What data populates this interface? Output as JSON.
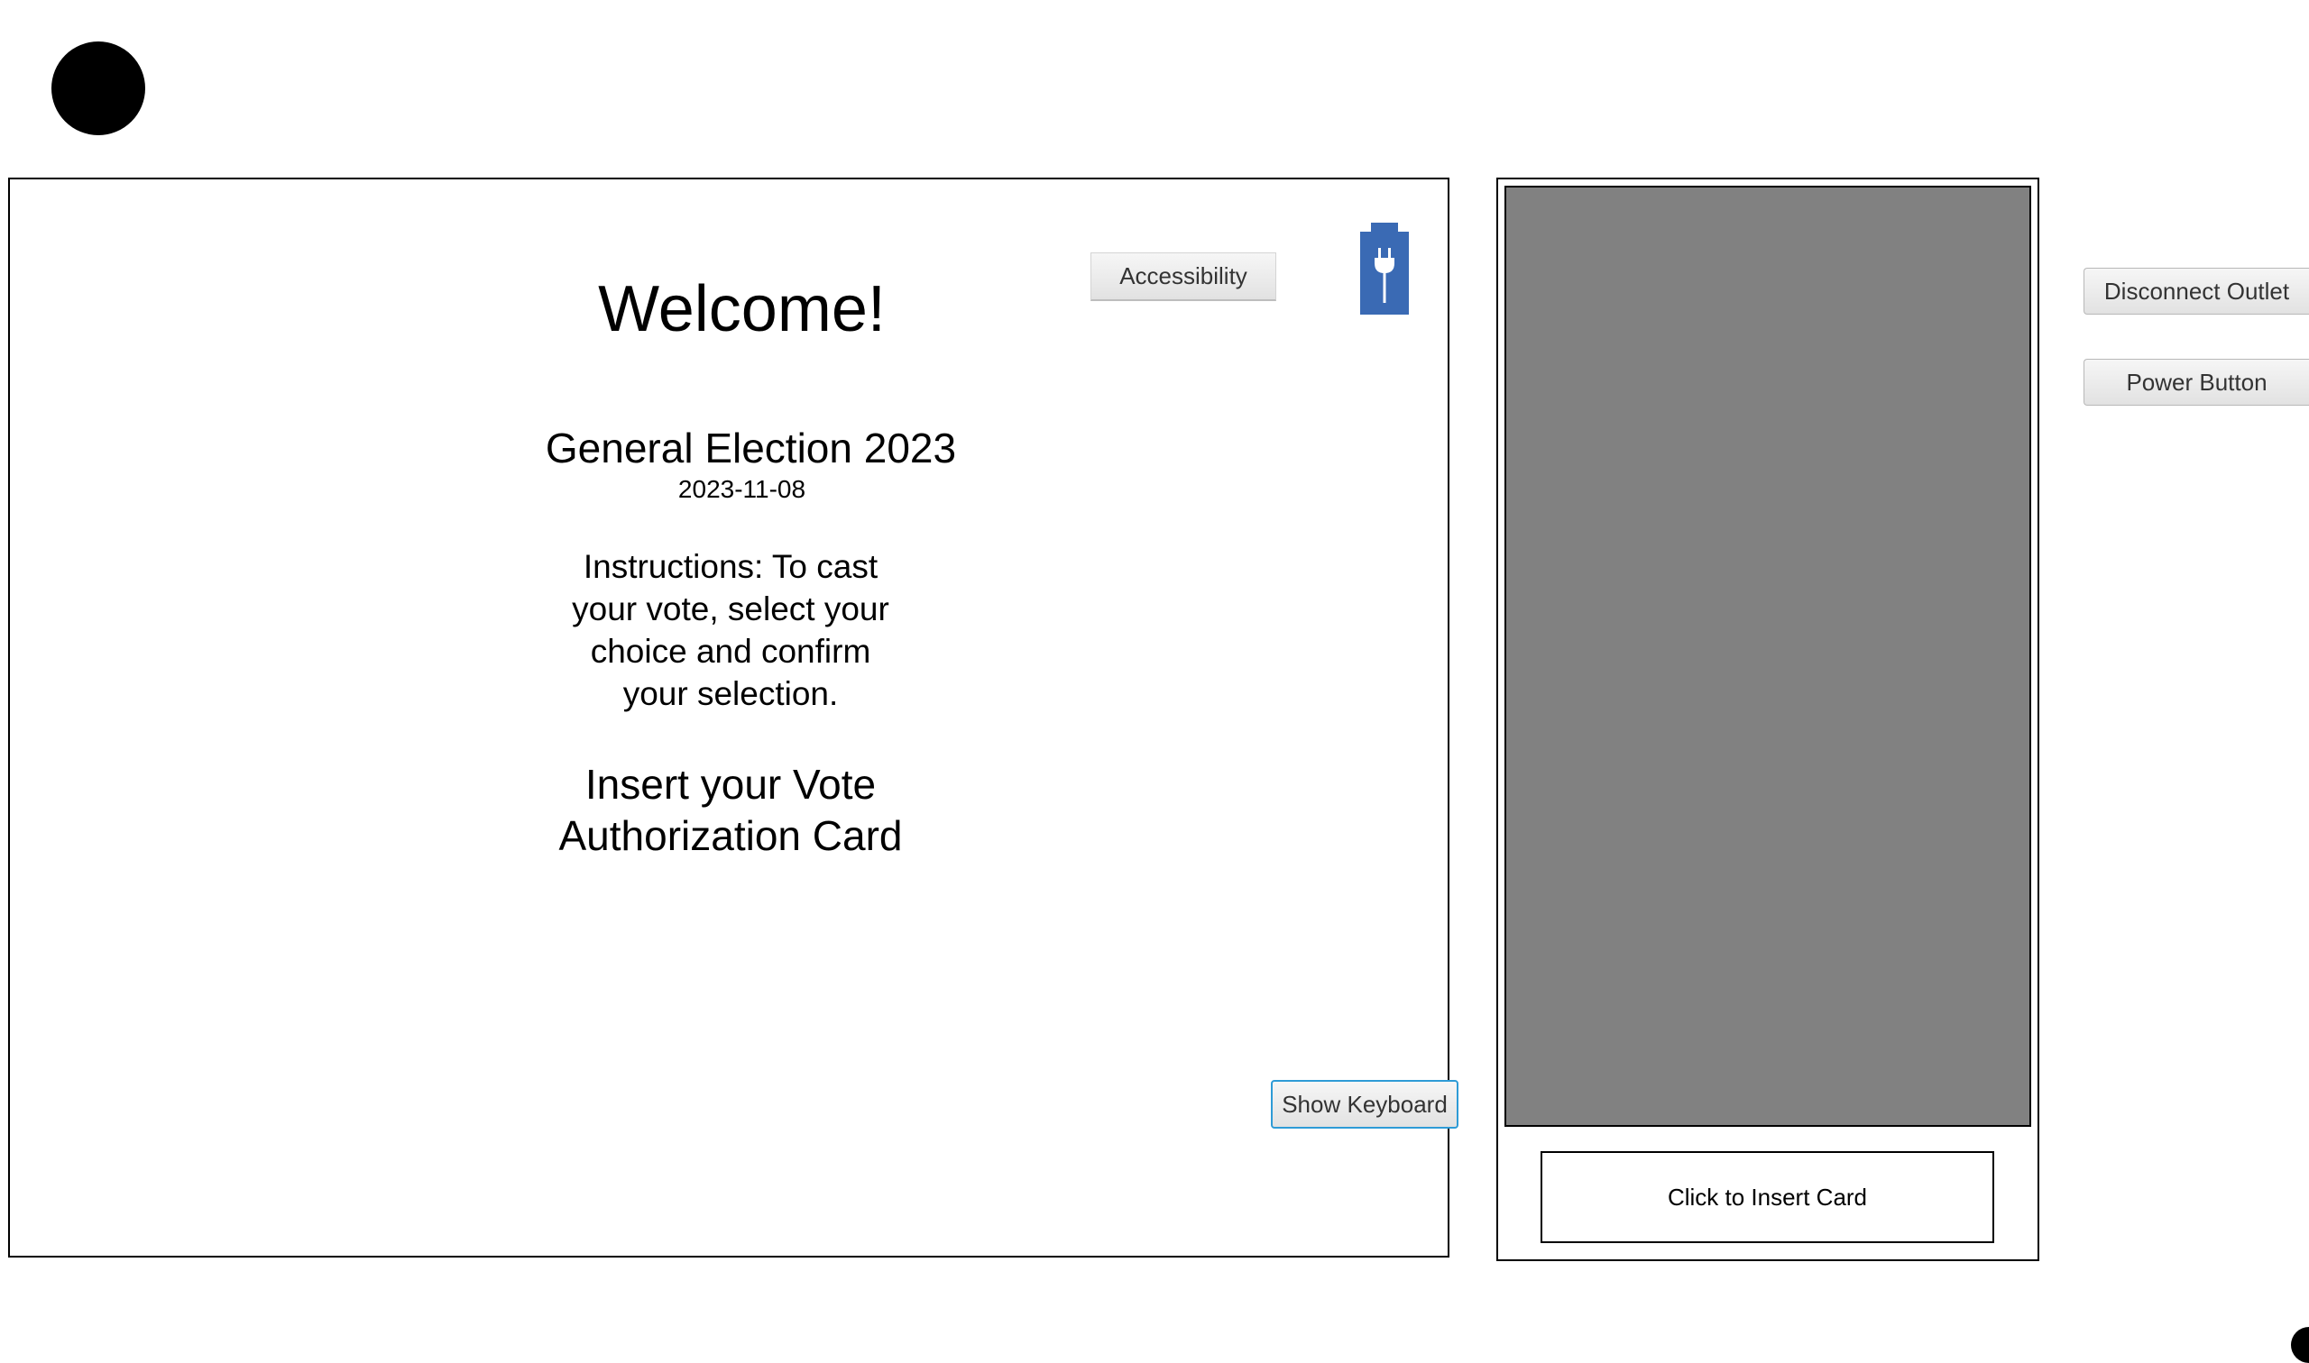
{
  "colors": {
    "plug_icon_bg": "#3a6ab4",
    "card_slot_gray": "#818181",
    "keyboard_focus_border": "#2e9bd6"
  },
  "screen": {
    "welcome": "Welcome!",
    "election_name": "General Election 2023",
    "election_date": "2023-11-08",
    "instructions": "Instructions: To cast your vote, select your choice and confirm your selection.",
    "insert_prompt": "Insert your Vote Authorization Card",
    "accessibility_label": "Accessibility",
    "show_keyboard_label": "Show Keyboard",
    "power_status_icon": "plug-icon"
  },
  "card_reader": {
    "insert_label": "Click to Insert Card"
  },
  "controls": {
    "disconnect_label": "Disconnect Outlet",
    "power_label": "Power Button"
  }
}
